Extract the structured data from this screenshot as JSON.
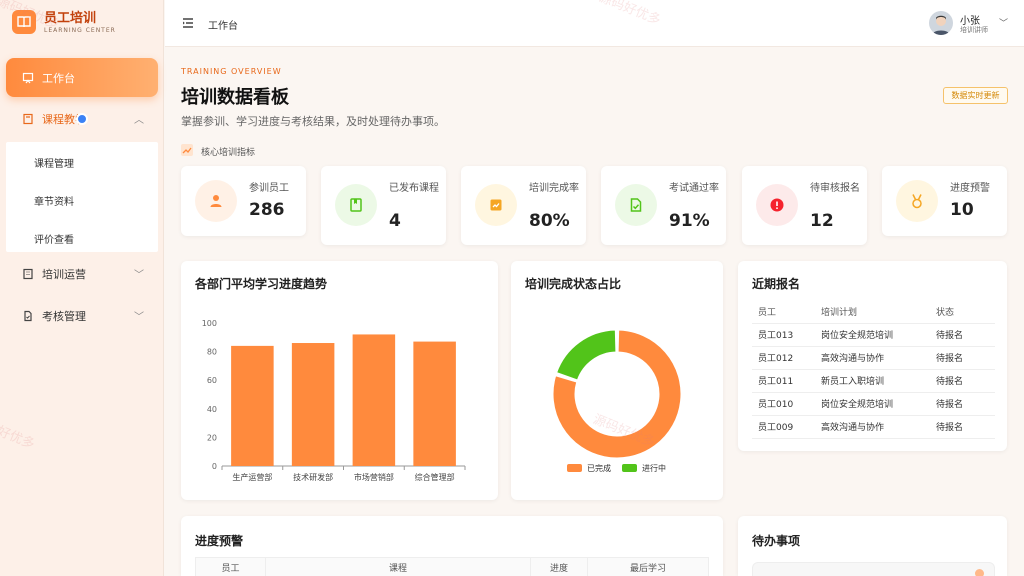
{
  "brand": {
    "title": "员工培训",
    "subtitle": "LEARNING CENTER"
  },
  "sidebar": {
    "items": [
      {
        "label": "工作台"
      },
      {
        "label": "课程教学"
      },
      {
        "label": "培训运营"
      },
      {
        "label": "考核管理"
      }
    ],
    "sub_items": [
      {
        "label": "课程管理"
      },
      {
        "label": "章节资料"
      },
      {
        "label": "评价查看"
      }
    ]
  },
  "header": {
    "breadcrumb": "工作台",
    "user_name": "小张",
    "user_role": "培训讲师"
  },
  "overview": {
    "eyebrow": "TRAINING OVERVIEW",
    "title": "培训数据看板",
    "subtitle": "掌握参训、学习进度与考核结果，及时处理待办事项。",
    "badge": "数据实时更新",
    "section_label": "核心培训指标"
  },
  "stats": [
    {
      "label": "参训员工",
      "value": "286",
      "color": "#ff8a3d",
      "bg": "#fff1e6"
    },
    {
      "label": "已发布课程",
      "value": "4",
      "color": "#52c41a",
      "bg": "#ecf9e6"
    },
    {
      "label": "培训完成率",
      "value": "80%",
      "color": "#f5a623",
      "bg": "#fff6e0"
    },
    {
      "label": "考试通过率",
      "value": "91%",
      "color": "#52c41a",
      "bg": "#ecf9e6"
    },
    {
      "label": "待审核报名",
      "value": "12",
      "color": "#f5222d",
      "bg": "#fdeaea"
    },
    {
      "label": "进度预警",
      "value": "10",
      "color": "#f5a623",
      "bg": "#fff6e0"
    }
  ],
  "bar_panel": {
    "title": "各部门平均学习进度趋势"
  },
  "donut_panel": {
    "title": "培训完成状态占比"
  },
  "chart_data": [
    {
      "type": "bar",
      "title": "各部门平均学习进度趋势",
      "categories": [
        "生产运营部",
        "技术研发部",
        "市场营销部",
        "综合管理部"
      ],
      "values": [
        84,
        86,
        92,
        87
      ],
      "ylim": [
        0,
        100
      ],
      "yticks": [
        0,
        20,
        40,
        60,
        80,
        100
      ],
      "color": "#ff8a3d"
    },
    {
      "type": "pie",
      "title": "培训完成状态占比",
      "labels": [
        "已完成",
        "进行中"
      ],
      "values": [
        80,
        20
      ],
      "colors": [
        "#ff8a3d",
        "#52c41a"
      ]
    }
  ],
  "recent": {
    "title": "近期报名",
    "columns": [
      "员工",
      "培训计划",
      "状态"
    ],
    "rows": [
      [
        "员工013",
        "岗位安全规范培训",
        "待报名"
      ],
      [
        "员工012",
        "高效沟通与协作",
        "待报名"
      ],
      [
        "员工011",
        "新员工入职培训",
        "待报名"
      ],
      [
        "员工010",
        "岗位安全规范培训",
        "待报名"
      ],
      [
        "员工009",
        "高效沟通与协作",
        "待报名"
      ]
    ]
  },
  "warning": {
    "title": "进度预警",
    "columns": [
      "员工",
      "课程",
      "进度",
      "最后学习"
    ]
  },
  "todo": {
    "title": "待办事项"
  },
  "watermark": "源码好优多"
}
